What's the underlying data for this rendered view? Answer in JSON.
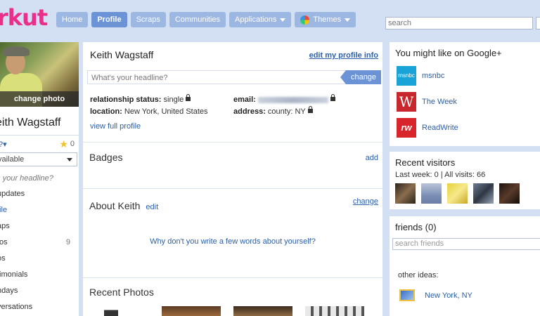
{
  "logo": "rkut",
  "nav": {
    "items": [
      {
        "label": "Home",
        "active": false
      },
      {
        "label": "Profile",
        "active": true
      },
      {
        "label": "Scraps",
        "active": false
      },
      {
        "label": "Communities",
        "active": false
      },
      {
        "label": "Applications",
        "active": false
      },
      {
        "label": "Themes",
        "active": false
      }
    ],
    "search_placeholder": "search"
  },
  "left": {
    "change_photo": "change photo",
    "name": "eith Wagstaff",
    "status_question": "?",
    "stars": "0",
    "status_value": "vailable",
    "headline_prompt": "t's your headline?",
    "links": [
      {
        "label": "updates",
        "count": ""
      },
      {
        "label": "file",
        "count": ""
      },
      {
        "label": "aps",
        "count": ""
      },
      {
        "label": "tos",
        "count": "9"
      },
      {
        "label": "os",
        "count": ""
      },
      {
        "label": "timonials",
        "count": ""
      },
      {
        "label": "ndays",
        "count": ""
      },
      {
        "label": "versations",
        "count": ""
      }
    ]
  },
  "profile": {
    "name": "Keith Wagstaff",
    "edit_link": "edit my profile info",
    "headline_placeholder": "What's your headline?",
    "headline_button": "change",
    "relationship_label": "relationship status:",
    "relationship_value": "single",
    "location_label": "location:",
    "location_value": "New York, United States",
    "email_label": "email:",
    "address_label": "address:",
    "address_value": "county: NY",
    "view_full": "view full profile"
  },
  "badges": {
    "title": "Badges",
    "action": "add"
  },
  "about": {
    "title": "About Keith",
    "edit": "edit",
    "change": "change",
    "prompt": "Why don't you write a few words about yourself?"
  },
  "photos": {
    "title": "Recent Photos"
  },
  "google_plus": {
    "title": "You might like on Google+",
    "items": [
      {
        "name": "msnbc",
        "logo_text": "msnbc",
        "color": "#1aa3d6"
      },
      {
        "name": "The Week",
        "logo_text": "W",
        "color": "#c8282d"
      },
      {
        "name": "ReadWrite",
        "logo_text": "rw",
        "color": "#d8242b"
      }
    ]
  },
  "visitors": {
    "title": "Recent visitors",
    "summary": "Last week: 0 | All visits: 66"
  },
  "friends": {
    "title": "friends (0)",
    "search_placeholder": "search friends",
    "other_ideas": "other ideas:",
    "ideas": [
      {
        "label": "New York, NY"
      }
    ]
  },
  "colors": {
    "accent": "#6b93d6",
    "nav": "#9db7e3",
    "background": "#d3dff2",
    "logo": "#e8308a"
  }
}
